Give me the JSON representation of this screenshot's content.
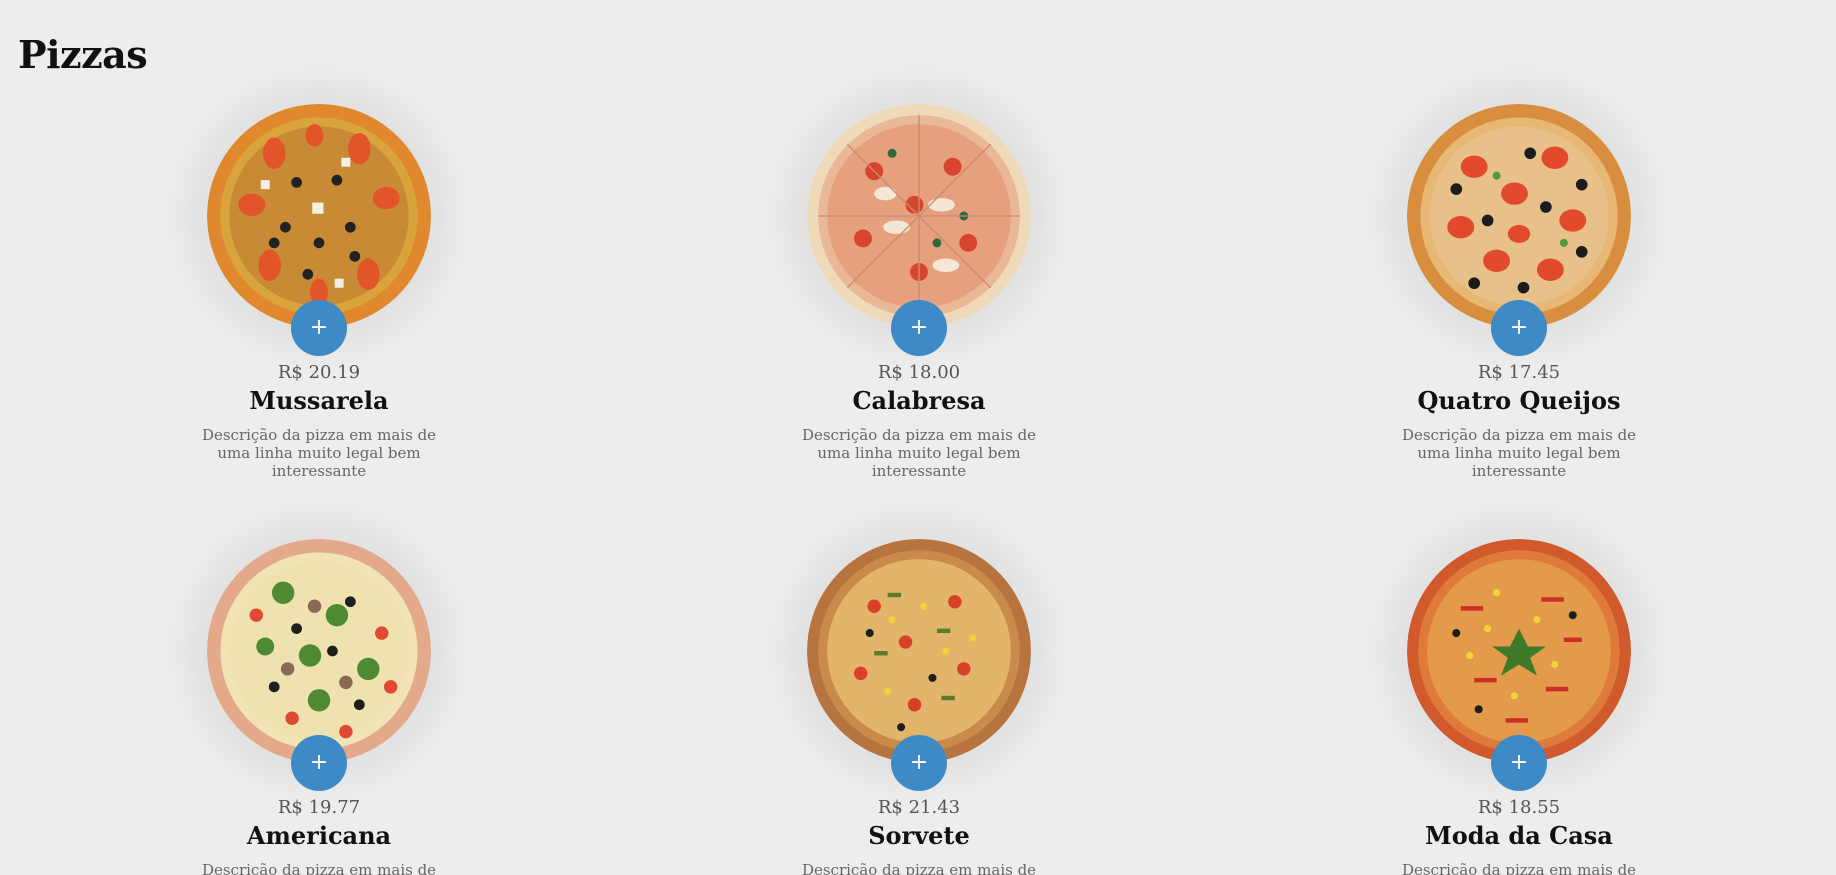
{
  "page": {
    "title": "Pizzas"
  },
  "colors": {
    "background": "#ededed",
    "accent": "#3d8ac6",
    "text": "#111111",
    "muted": "#666666"
  },
  "pizzas": [
    {
      "name": "Mussarela",
      "price": "R$ 20.19",
      "description": "Descrição da pizza em mais de uma linha muito legal bem interessante",
      "add_label": "+",
      "image": "mussarela-pizza-image"
    },
    {
      "name": "Calabresa",
      "price": "R$ 18.00",
      "description": "Descrição da pizza em mais de uma linha muito legal bem interessante",
      "add_label": "+",
      "image": "calabresa-pizza-image"
    },
    {
      "name": "Quatro Queijos",
      "price": "R$ 17.45",
      "description": "Descrição da pizza em mais de uma linha muito legal bem interessante",
      "add_label": "+",
      "image": "quatro-queijos-pizza-image"
    },
    {
      "name": "Americana",
      "price": "R$ 19.77",
      "description": "Descrição da pizza em mais de uma linha muito legal bem interessante",
      "add_label": "+",
      "image": "americana-pizza-image"
    },
    {
      "name": "Sorvete",
      "price": "R$ 21.43",
      "description": "Descrição da pizza em mais de uma linha muito legal bem interessante",
      "add_label": "+",
      "image": "sorvete-pizza-image"
    },
    {
      "name": "Moda da Casa",
      "price": "R$ 18.55",
      "description": "Descrição da pizza em mais de uma linha muito legal bem interessante",
      "add_label": "+",
      "image": "moda-da-casa-pizza-image"
    }
  ]
}
